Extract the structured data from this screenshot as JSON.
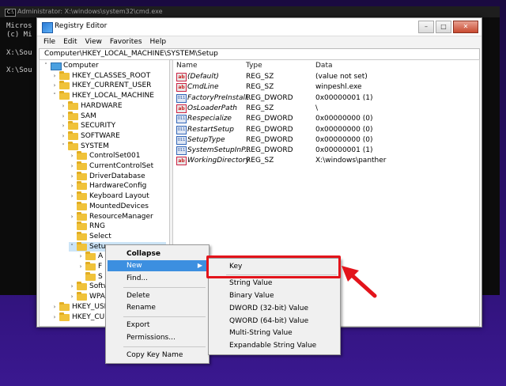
{
  "cmd": {
    "title": "Administrator: X:\\windows\\system32\\cmd.exe",
    "lines": [
      "Micros",
      "(c) Mi",
      "X:\\Sou",
      "X:\\Sou"
    ]
  },
  "regedit": {
    "title": "Registry Editor",
    "menu": [
      "File",
      "Edit",
      "View",
      "Favorites",
      "Help"
    ],
    "address": "Computer\\HKEY_LOCAL_MACHINE\\SYSTEM\\Setup",
    "tree": [
      {
        "label": "Computer",
        "level": 0,
        "chev": "v",
        "icon": "computer"
      },
      {
        "label": "HKEY_CLASSES_ROOT",
        "level": 1,
        "chev": ">"
      },
      {
        "label": "HKEY_CURRENT_USER",
        "level": 1,
        "chev": ">"
      },
      {
        "label": "HKEY_LOCAL_MACHINE",
        "level": 1,
        "chev": "v"
      },
      {
        "label": "HARDWARE",
        "level": 2,
        "chev": ">"
      },
      {
        "label": "SAM",
        "level": 2,
        "chev": ">"
      },
      {
        "label": "SECURITY",
        "level": 2,
        "chev": ">"
      },
      {
        "label": "SOFTWARE",
        "level": 2,
        "chev": ">"
      },
      {
        "label": "SYSTEM",
        "level": 2,
        "chev": "v"
      },
      {
        "label": "ControlSet001",
        "level": 3,
        "chev": ">"
      },
      {
        "label": "CurrentControlSet",
        "level": 3,
        "chev": ">"
      },
      {
        "label": "DriverDatabase",
        "level": 3,
        "chev": ">"
      },
      {
        "label": "HardwareConfig",
        "level": 3,
        "chev": ">"
      },
      {
        "label": "Keyboard Layout",
        "level": 3,
        "chev": ">"
      },
      {
        "label": "MountedDevices",
        "level": 3,
        "chev": ""
      },
      {
        "label": "ResourceManager",
        "level": 3,
        "chev": ">"
      },
      {
        "label": "RNG",
        "level": 3,
        "chev": ""
      },
      {
        "label": "Select",
        "level": 3,
        "chev": ""
      },
      {
        "label": "Setup",
        "level": 3,
        "chev": "v",
        "selected": true
      },
      {
        "label": "A",
        "level": 4,
        "chev": ">"
      },
      {
        "label": "F",
        "level": 4,
        "chev": ">"
      },
      {
        "label": "S",
        "level": 4,
        "chev": ""
      },
      {
        "label": "Softw",
        "level": 3,
        "chev": ">"
      },
      {
        "label": "WPA",
        "level": 3,
        "chev": ">"
      },
      {
        "label": "HKEY_USE",
        "level": 1,
        "chev": ">"
      },
      {
        "label": "HKEY_CUR",
        "level": 1,
        "chev": ">"
      }
    ],
    "columns": {
      "name": "Name",
      "type": "Type",
      "data": "Data"
    },
    "values": [
      {
        "name": "(Default)",
        "type": "REG_SZ",
        "data": "(value not set)",
        "kind": "sz"
      },
      {
        "name": "CmdLine",
        "type": "REG_SZ",
        "data": "winpeshl.exe",
        "kind": "sz"
      },
      {
        "name": "FactoryPreInstall...",
        "type": "REG_DWORD",
        "data": "0x00000001 (1)",
        "kind": "dword"
      },
      {
        "name": "OsLoaderPath",
        "type": "REG_SZ",
        "data": "\\",
        "kind": "sz"
      },
      {
        "name": "Respecialize",
        "type": "REG_DWORD",
        "data": "0x00000000 (0)",
        "kind": "dword"
      },
      {
        "name": "RestartSetup",
        "type": "REG_DWORD",
        "data": "0x00000000 (0)",
        "kind": "dword"
      },
      {
        "name": "SetupType",
        "type": "REG_DWORD",
        "data": "0x00000000 (0)",
        "kind": "dword"
      },
      {
        "name": "SystemSetupInP...",
        "type": "REG_DWORD",
        "data": "0x00000001 (1)",
        "kind": "dword"
      },
      {
        "name": "WorkingDirectory",
        "type": "REG_SZ",
        "data": "X:\\windows\\panther",
        "kind": "sz"
      }
    ]
  },
  "context_menu": {
    "collapse": "Collapse",
    "new": "New",
    "find": "Find...",
    "delete": "Delete",
    "rename": "Rename",
    "export": "Export",
    "permissions": "Permissions...",
    "copy_key_name": "Copy Key Name"
  },
  "submenu": {
    "key": "Key",
    "string_value": "String Value",
    "binary_value": "Binary Value",
    "dword_value": "DWORD (32-bit) Value",
    "qword_value": "QWORD (64-bit) Value",
    "multi_string": "Multi-String Value",
    "expandable_string": "Expandable String Value"
  },
  "colors": {
    "highlight": "#3c8fe0",
    "annotation": "#e3141b"
  }
}
